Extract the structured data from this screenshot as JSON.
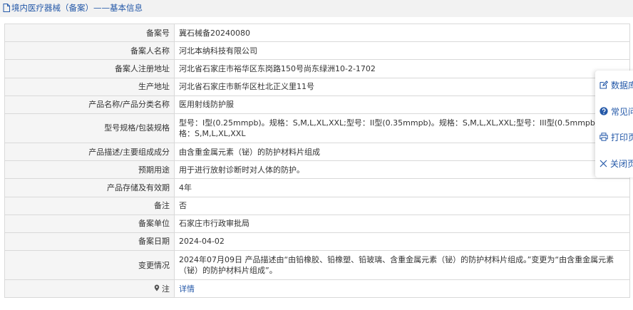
{
  "page": {
    "title": "境内医疗器械（备案）——基本信息"
  },
  "rows": [
    {
      "label": "备案号",
      "value": "冀石械备20240080"
    },
    {
      "label": "备案人名称",
      "value": "河北本纳科技有限公司"
    },
    {
      "label": "备案人注册地址",
      "value": "河北省石家庄市裕华区东岗路150号尚东绿洲10-2-1702"
    },
    {
      "label": "生产地址",
      "value": "河北省石家庄市新华区杜北正义里11号"
    },
    {
      "label": "产品名称/产品分类名称",
      "value": "医用射线防护服"
    },
    {
      "label": "型号规格/包装规格",
      "value": "型号：I型(0.25mmpb)。规格：S,M,L,XL,XXL;型号：II型(0.35mmpb)。规格：S,M,L,XL,XXL;型号：III型(0.5mmpb)。规格：S,M,L,XL,XXL"
    },
    {
      "label": "产品描述/主要组成成分",
      "value": "由含重金属元素（铋）的防护材料片组成"
    },
    {
      "label": "预期用途",
      "value": "用于进行放射诊断时对人体的防护。"
    },
    {
      "label": "产品存储及有效期",
      "value": "4年"
    },
    {
      "label": "备注",
      "value": "否"
    },
    {
      "label": "备案单位",
      "value": "石家庄市行政审批局"
    },
    {
      "label": "备案日期",
      "value": "2024-04-02"
    },
    {
      "label": "变更情况",
      "value": "2024年07月09日 产品描述由“由铅橡胶、铅橡塑、铅玻璃、含重金属元素（铋）的防护材料片组成。”变更为“由含重金属元素（铋）的防护材料片组成”。"
    }
  ],
  "note_row": {
    "label": "注",
    "link": "详情"
  },
  "side_panel": {
    "items": [
      {
        "label": "数据库",
        "icon": "edit-icon"
      },
      {
        "label": "常见问题",
        "icon": "help-icon"
      },
      {
        "label": "打印页面",
        "icon": "print-icon"
      },
      {
        "label": "关闭页面",
        "icon": "close-icon"
      }
    ]
  },
  "colors": {
    "link": "#2458a8",
    "label_bg": "#f5f5f5",
    "border": "#d9d9d9"
  }
}
